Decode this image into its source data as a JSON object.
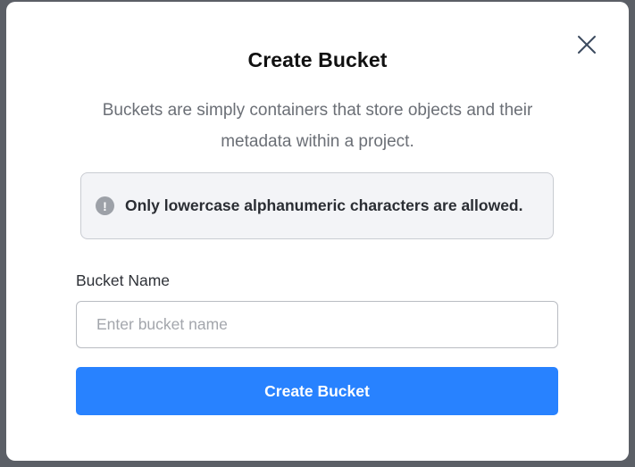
{
  "modal": {
    "title": "Create Bucket",
    "description": "Buckets are simply containers that store objects and their metadata within a project.",
    "alert": {
      "icon": "exclamation-circle-icon",
      "text": "Only lowercase alphanumeric characters are allowed."
    },
    "field": {
      "label": "Bucket Name",
      "value": "",
      "placeholder": "Enter bucket name"
    },
    "submit_label": "Create Bucket",
    "close_icon": "close-icon"
  },
  "colors": {
    "overlay": "#5b5f66",
    "primary": "#2882ff",
    "alert_background": "#f3f4f7",
    "alert_icon": "#9da1a8"
  }
}
